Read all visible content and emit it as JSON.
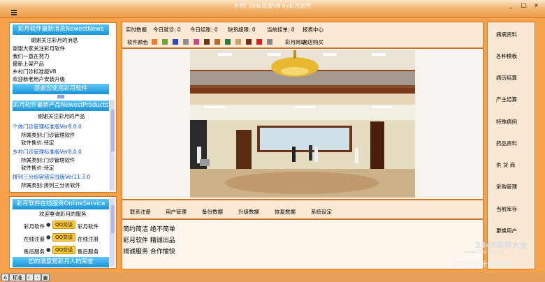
{
  "window": {
    "title": "乡村门诊标准版V8 by彩月软件",
    "min": "_",
    "max": "□",
    "close": "×"
  },
  "news": {
    "header": "彩月软件最新消息NewestNews",
    "welcome": "谢谢关注彩月的消息",
    "items": [
      "谢谢大家关注彩月软件",
      "我们一直在努力",
      "最新上架产品",
      "乡村门诊标准版V8",
      "欢迎新老用户安装升级"
    ],
    "footer": "感谢您使用彩月软件"
  },
  "products": {
    "header": "彩月软件最新产品NewestProducts",
    "welcome": "谢谢关注彩月的产品",
    "items": [
      {
        "name": "个体门诊管理标准版Ver8.0.0",
        "category": "所属类别:门诊管理软件",
        "price": "软件售价:待定"
      },
      {
        "name": "乡村门诊管理标准版Ver8.0.0",
        "category": "所属类别:门诊管理软件",
        "price": "软件售价:待定"
      },
      {
        "name": "排列三分组容错实战版Ver11.3.0",
        "category": "所属类别:排列三分析软件"
      }
    ]
  },
  "service": {
    "header": "彩月软件在线服务OnlineService",
    "welcome": "欢迎垂询彩月的服务",
    "rows": [
      {
        "left": "彩月软件",
        "qq": "QQ交谈",
        "right": "彩月软件"
      },
      {
        "left": "在线注册",
        "qq": "QQ交谈",
        "right": "在线注册"
      },
      {
        "left": "售后服务",
        "qq": "QQ交谈",
        "right": "售后服务"
      }
    ],
    "footer": "您的满意是彩月人的荣誉"
  },
  "toolbar": {
    "items": [
      "实时数据",
      "今日就诊: 0",
      "今日结账: 0",
      "缺货超限: 0",
      "当前挂单: 0",
      "报表中心"
    ],
    "color_label": "软件颜色",
    "links": [
      "彩月网站",
      "网店购买"
    ],
    "swatches": [
      "#e87f2c",
      "#6fa63c",
      "#2c49c9",
      "#8f8f8f",
      "#c94a84",
      "#6a3a12",
      "#b86a2a",
      "#2f7a3a",
      "#c9a06a",
      "#7a2a1a",
      "#cc2222",
      "#888888"
    ]
  },
  "bottom_menu": [
    "联系注册",
    "用户管理",
    "备份数据",
    "升级数据",
    "恢复数据",
    "系统设定"
  ],
  "taglines": [
    "简约简洁 绝不简单",
    "彩月软件 精诚出品",
    "竭诚服务 合作愉快"
  ],
  "side_menu": [
    "病病资料",
    "各种模板",
    "病历结算",
    "产主结算",
    "特殊病例",
    "药品资料",
    "供 货 商",
    "采购管理",
    "当前库存",
    "更换用户"
  ],
  "status": {
    "input_mode": "A",
    "mode_label": "标准",
    "moon": "☾",
    "dot": "·",
    "grid": "▦"
  },
  "watermark": {
    "brand": "2345软件大全",
    "url": "www.DuoTe.com",
    "slogan": "国内最安全的软件站"
  }
}
